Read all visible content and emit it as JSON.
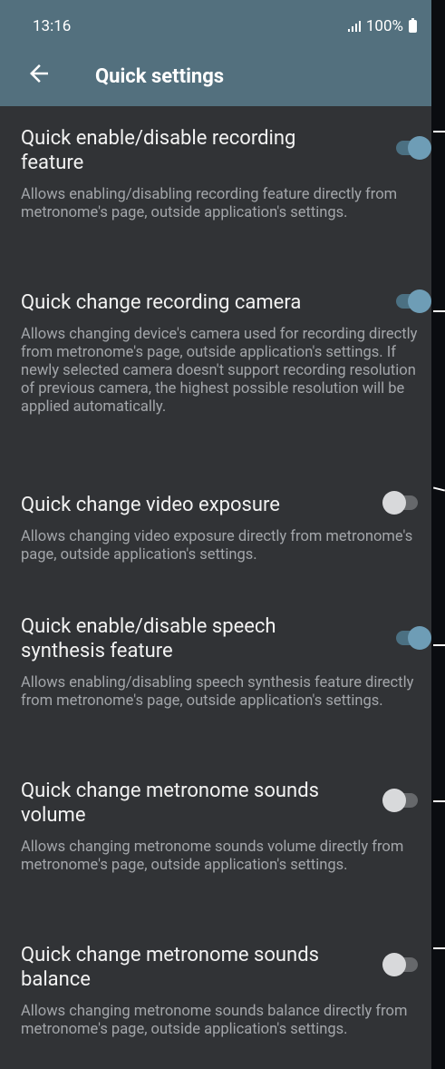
{
  "status_bar": {
    "time": "13:16",
    "battery": "100%"
  },
  "app_bar": {
    "title": "Quick settings",
    "back_icon": "arrow-left-icon"
  },
  "settings": [
    {
      "title": "Quick enable/disable recording feature",
      "description": "Allows enabling/disabling recording feature directly from metronome's page, outside application's settings.",
      "enabled": true
    },
    {
      "title": "Quick change recording camera",
      "description": "Allows changing device's camera used for recording directly from metronome's page, outside application's settings. If newly selected camera doesn't support recording resolution of previous camera, the highest possible resolution will be applied automatically.",
      "enabled": true
    },
    {
      "title": "Quick change video exposure",
      "description": "Allows changing video exposure directly from metronome's page, outside application's settings.",
      "enabled": false
    },
    {
      "title": "Quick enable/disable speech synthesis feature",
      "description": "Allows enabling/disabling speech synthesis feature directly from metronome's page, outside application's settings.",
      "enabled": true
    },
    {
      "title": "Quick change metronome sounds volume",
      "description": "Allows changing metronome sounds volume directly from metronome's page, outside application's settings.",
      "enabled": false
    },
    {
      "title": "Quick change metronome sounds balance",
      "description": "Allows changing metronome sounds balance directly from metronome's page, outside application's settings.",
      "enabled": false
    }
  ],
  "colors": {
    "app_bar": "#53707e",
    "background": "#313336",
    "toggle_on_track": "#4b7082",
    "toggle_on_thumb": "#6e9db6",
    "toggle_off_track": "#66686b",
    "toggle_off_thumb": "#d8d9db"
  }
}
